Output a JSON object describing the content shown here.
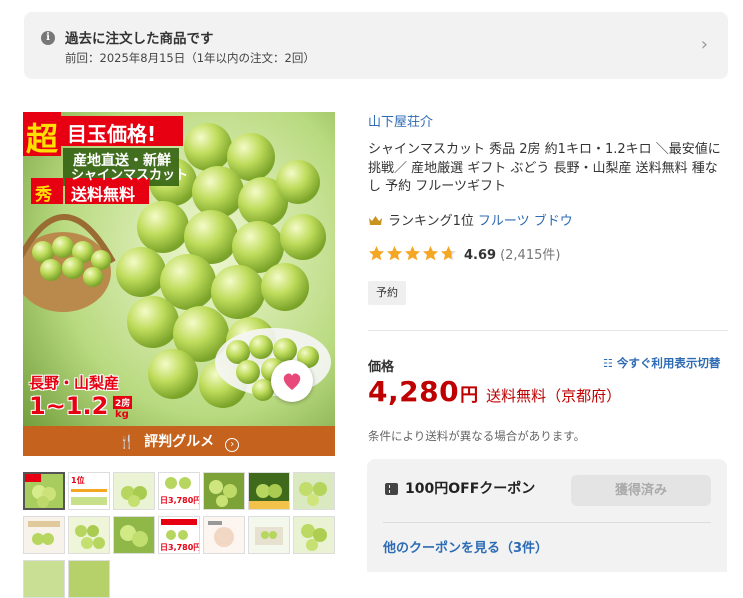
{
  "notice": {
    "title": "過去に注文した商品です",
    "subtitle": "前回：2025年8月15日（1年以内の注文：2回）"
  },
  "product_image": {
    "headline": "目玉価格!",
    "super_label": "超",
    "tagline_1": "産地直送・新鮮",
    "tagline_2": "シャインマスカット",
    "grade_label": "秀",
    "shipping_label": "送料無料",
    "origin_label": "長野・山梨産",
    "weight_label": "1~1.2",
    "weight_unit_top": "2房",
    "weight_unit_bottom": "kg",
    "banner_label": "評判グルメ"
  },
  "thumbnails": {
    "price_text_1": "日3,780円",
    "price_text_2": "日3,780円"
  },
  "shop_name": "山下屋荘介",
  "product_title": "シャインマスカット 秀品 2房 約1キロ・1.2キロ ＼最安値に挑戦／ 産地厳選 ギフト ぶどう 長野・山梨産 送料無料 種なし 予約 フルーツギフト",
  "ranking": {
    "label": "ランキング1位",
    "category": "フルーツ ブドウ"
  },
  "rating": {
    "average": "4.69",
    "count": "(2,415件)",
    "stars_value": 4.69
  },
  "badge": "予約",
  "price_section": {
    "label": "価格",
    "toggle_label": "今すぐ利用表示切替",
    "amount": "4,280",
    "currency": "円",
    "shipping": "送料無料（京都府）",
    "note": "条件により送料が異なる場合があります。"
  },
  "coupon": {
    "title": "100円OFFクーポン",
    "button_label": "獲得済み",
    "link_label": "他のクーポンを見る（3件）"
  },
  "colors": {
    "accent_red": "#bf0000",
    "link_blue": "#2d6bb4",
    "star_gold": "#f5a623"
  }
}
